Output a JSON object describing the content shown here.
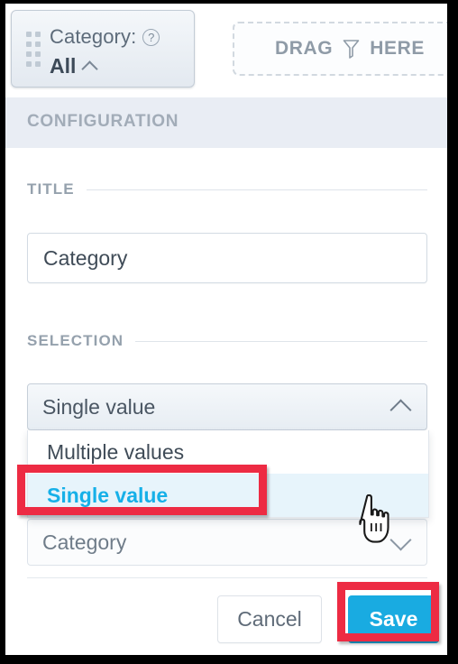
{
  "topbar": {
    "filter_chip": {
      "drag_handle_icon": "drag-dots-icon",
      "label": "Category:",
      "help_icon": "?",
      "value": "All",
      "chevron_icon": "chevron-up-icon"
    },
    "dropzone": {
      "text_before": "DRAG",
      "icon": "funnel-icon",
      "text_after": "HERE"
    }
  },
  "config_header": {
    "title": "CONFIGURATION"
  },
  "sections": {
    "title": {
      "label": "TITLE",
      "input_value": "Category",
      "input_placeholder": "Category"
    },
    "selection": {
      "label": "SELECTION",
      "selected_value": "Single value",
      "chevron_icon": "chevron-up-icon",
      "options": [
        {
          "label": "Multiple values",
          "selected": false
        },
        {
          "label": "Single value",
          "selected": true
        }
      ]
    },
    "field": {
      "value": "Category",
      "chevron_icon": "chevron-down-icon"
    }
  },
  "footer": {
    "cancel_label": "Cancel",
    "save_label": "Save"
  },
  "colors": {
    "accent_cyan": "#19ABE1",
    "annotation_red": "#ED2B43",
    "selected_option_text": "#16b0e8",
    "selected_option_bg": "#e7f4fb",
    "config_header_bg": "#e9edf4",
    "section_label": "#95a1ad"
  },
  "cursor": {
    "icon": "pointing-hand-cursor"
  }
}
